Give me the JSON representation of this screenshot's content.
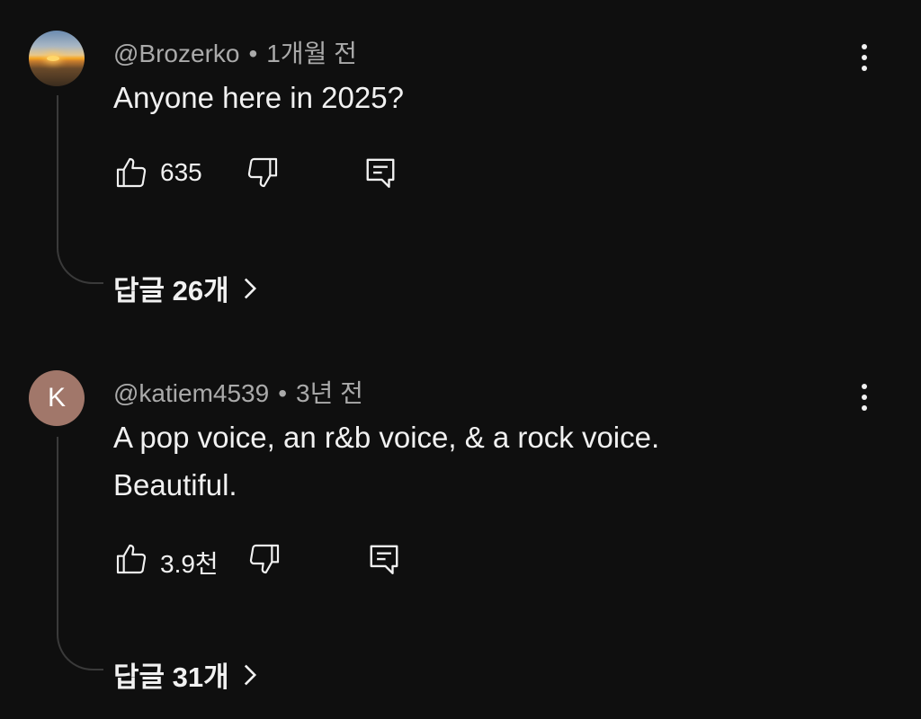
{
  "comments": [
    {
      "author": "@Brozerko",
      "separator": "•",
      "time": "1개월 전",
      "text": "Anyone here in 2025?",
      "likes": "635",
      "replies_label": "답글 26개",
      "avatar_icon": "sunset-photo-avatar"
    },
    {
      "author": "@katiem4539",
      "separator": "•",
      "time": "3년 전",
      "text": "A pop voice, an r&b voice, & a rock voice. Beautiful.",
      "likes": "3.9천",
      "replies_label": "답글 31개",
      "avatar_letter": "K",
      "avatar_color": "#a1776a"
    }
  ],
  "icons": {
    "like": "thumbs-up-icon",
    "dislike": "thumbs-down-icon",
    "reply": "reply-comment-icon",
    "more": "more-vertical-icon",
    "chevron": "chevron-right-icon"
  }
}
